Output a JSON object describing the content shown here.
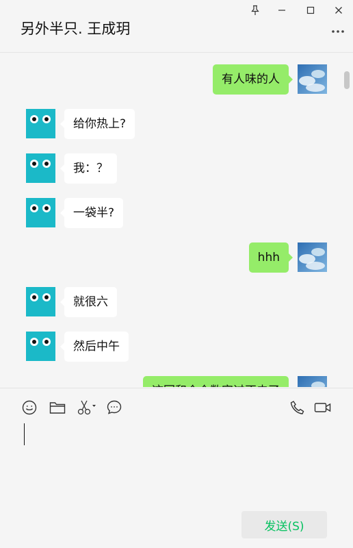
{
  "window": {
    "title": "另外半只. 王成玥"
  },
  "messages": [
    {
      "side": "right",
      "text": "有人味的人"
    },
    {
      "side": "left",
      "text": "给你热上?"
    },
    {
      "side": "left",
      "text": "我：？"
    },
    {
      "side": "left",
      "text": "一袋半?"
    },
    {
      "side": "right",
      "text": "hhh"
    },
    {
      "side": "left",
      "text": "就很六"
    },
    {
      "side": "left",
      "text": "然后中午"
    },
    {
      "side": "right",
      "text": "这回和个个数字过不去了"
    }
  ],
  "composer": {
    "send_label": "发送(S)"
  },
  "icons": {
    "pin": "pin-icon",
    "minimize": "minimize-icon",
    "maximize": "maximize-icon",
    "close": "close-icon",
    "more": "more-icon",
    "emoji": "emoji-icon",
    "file": "folder-icon",
    "screenshot": "scissors-icon",
    "chat_history": "chat-bubble-icon",
    "voice_call": "phone-icon",
    "video_call": "video-icon"
  },
  "colors": {
    "self_bubble": "#95ec69",
    "other_bubble": "#ffffff",
    "other_avatar": "#1bb9c8",
    "send_text": "#07c160"
  }
}
